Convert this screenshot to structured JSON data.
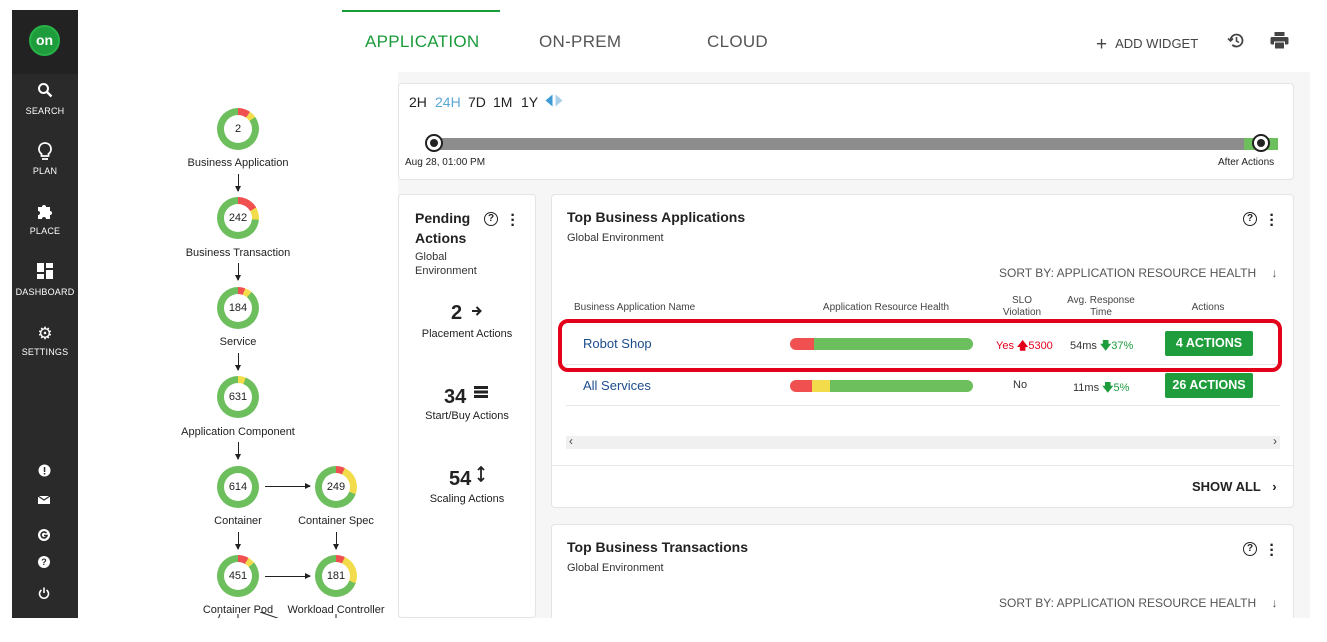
{
  "sidebar": {
    "logo": "on",
    "items": [
      {
        "label": "SEARCH",
        "icon": "search-icon"
      },
      {
        "label": "PLAN",
        "icon": "lightbulb-icon"
      },
      {
        "label": "PLACE",
        "icon": "puzzle-icon"
      },
      {
        "label": "DASHBOARD",
        "icon": "dashboard-icon"
      },
      {
        "label": "SETTINGS",
        "icon": "gear-icon"
      }
    ],
    "footer_icons": [
      "alert-icon",
      "mail-icon",
      "google-icon",
      "help-icon",
      "power-icon"
    ]
  },
  "tabs": [
    "APPLICATION",
    "ON-PREM",
    "CLOUD"
  ],
  "active_tab": "APPLICATION",
  "top_actions": {
    "add_widget": "ADD WIDGET",
    "history_icon": "history-icon",
    "print_icon": "print-icon"
  },
  "topology": {
    "nodes": [
      {
        "count": "2",
        "label": "Business Application"
      },
      {
        "count": "242",
        "label": "Business Transaction"
      },
      {
        "count": "184",
        "label": "Service"
      },
      {
        "count": "631",
        "label": "Application Component"
      },
      {
        "count": "614",
        "label": "Container"
      },
      {
        "count": "249",
        "label": "Container Spec"
      },
      {
        "count": "451",
        "label": "Container Pod"
      },
      {
        "count": "181",
        "label": "Workload Controller"
      }
    ]
  },
  "timeline": {
    "ranges": [
      "2H",
      "24H",
      "7D",
      "1M",
      "1Y"
    ],
    "active_range": "24H",
    "start_label": "Aug 28, 01:00 PM",
    "end_label": "After Actions"
  },
  "pending_actions": {
    "title": "Pending Actions",
    "subtitle": "Global Environment",
    "items": [
      {
        "count": "2",
        "label": "Placement Actions",
        "icon": "arrow-right-icon"
      },
      {
        "count": "34",
        "label": "Start/Buy Actions",
        "icon": "server-icon"
      },
      {
        "count": "54",
        "label": "Scaling Actions",
        "icon": "updown-arrow-icon"
      }
    ]
  },
  "top_business_applications": {
    "title": "Top Business Applications",
    "subtitle": "Global Environment",
    "sort_label": "SORT BY: APPLICATION RESOURCE HEALTH",
    "columns": [
      "Business Application Name",
      "Application Resource Health",
      "SLO Violation",
      "Avg. Response Time",
      "Actions"
    ],
    "rows": [
      {
        "name": "Robot Shop",
        "health": {
          "red": 0.13,
          "yellow": 0.0,
          "green": 0.87
        },
        "slo": "Yes",
        "slo_value": "5300",
        "response": "54ms",
        "response_change": "37%",
        "actions": "4 ACTIONS"
      },
      {
        "name": "All Services",
        "health": {
          "red": 0.12,
          "yellow": 0.1,
          "green": 0.78
        },
        "slo": "No",
        "slo_value": "",
        "response": "11ms",
        "response_change": "5%",
        "actions": "26 ACTIONS"
      }
    ],
    "show_all": "SHOW ALL"
  },
  "top_business_transactions": {
    "title": "Top Business Transactions",
    "subtitle": "Global Environment",
    "sort_label": "SORT BY: APPLICATION RESOURCE HEALTH"
  },
  "colors": {
    "green": "#1f9d3c",
    "health_red": "#f0504f",
    "health_yellow": "#f3dc4b",
    "health_green": "#6cbf5c",
    "highlight": "#e3001b",
    "link": "#1d4c8c"
  }
}
